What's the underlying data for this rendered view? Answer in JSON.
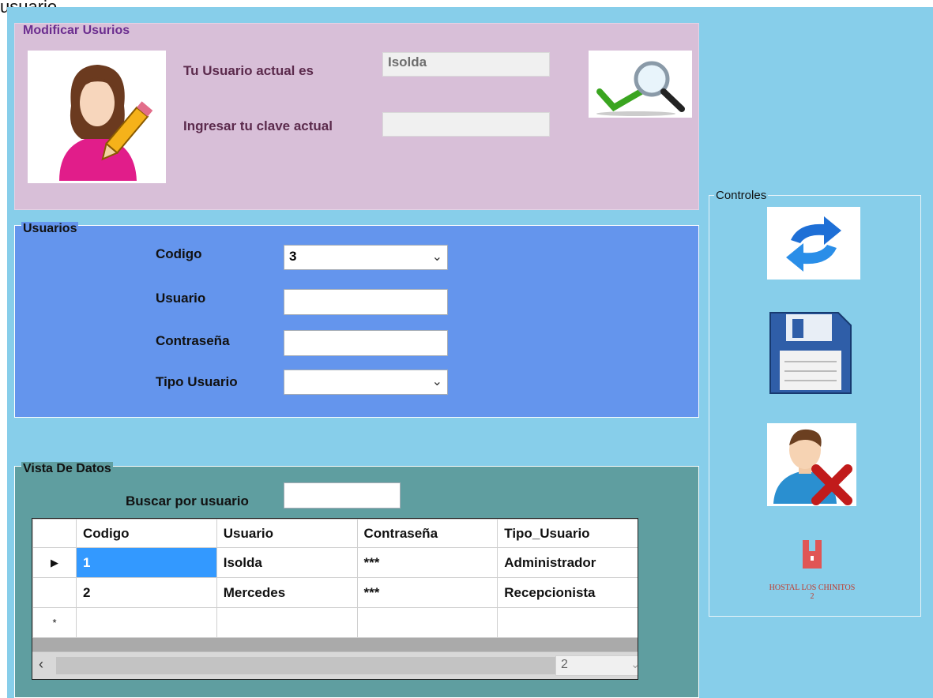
{
  "top_cut_text": "usuario.",
  "modificar": {
    "title": "Modificar Usurios",
    "current_user_label": "Tu Usuario actual es",
    "current_user_value": "Isolda",
    "current_pass_label": "Ingresar tu clave actual",
    "current_pass_value": ""
  },
  "usuarios": {
    "title": "Usuarios",
    "codigo_label": "Codigo",
    "codigo_value": "3",
    "usuario_label": "Usuario",
    "usuario_value": "",
    "contrasena_label": "Contraseña",
    "contrasena_value": "",
    "tipo_label": "Tipo Usuario",
    "tipo_value": ""
  },
  "vista": {
    "title": "Vista De Datos",
    "buscar_label": "Buscar por usuario",
    "buscar_value": "",
    "columns": [
      "Codigo",
      "Usuario",
      "Contraseña",
      "Tipo_Usuario"
    ],
    "rows": [
      {
        "marker": "▶",
        "codigo": "1",
        "usuario": "Isolda",
        "contrasena": "***",
        "tipo": "Administrador"
      },
      {
        "marker": "",
        "codigo": "2",
        "usuario": "Mercedes",
        "contrasena": "***",
        "tipo": "Recepcionista"
      }
    ],
    "new_row_marker": "*",
    "pager_value": "2"
  },
  "controles": {
    "title": "Controles",
    "logo_text": "HOSTAL LOS CHINITOS 2"
  }
}
